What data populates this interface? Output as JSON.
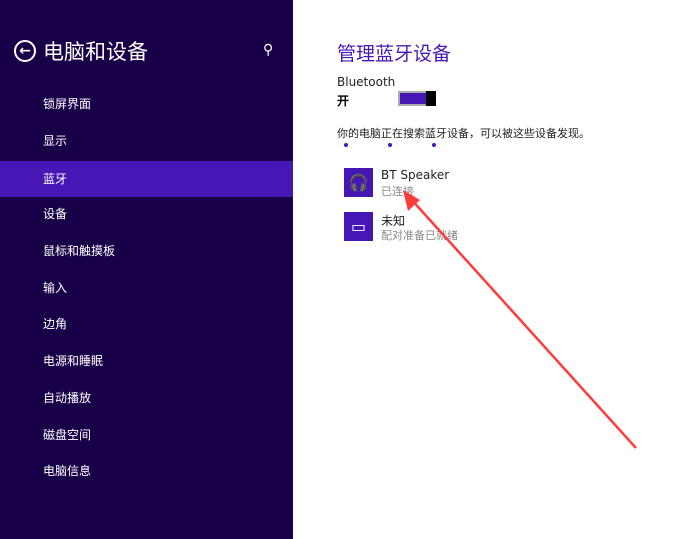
{
  "sidebar": {
    "title": "电脑和设备",
    "items": [
      {
        "label": "锁屏界面"
      },
      {
        "label": "显示"
      },
      {
        "label": "蓝牙",
        "selected": true
      },
      {
        "label": "设备"
      },
      {
        "label": "鼠标和触摸板"
      },
      {
        "label": "输入"
      },
      {
        "label": "边角"
      },
      {
        "label": "电源和睡眠"
      },
      {
        "label": "自动播放"
      },
      {
        "label": "磁盘空间"
      },
      {
        "label": "电脑信息"
      }
    ]
  },
  "main": {
    "title": "管理蓝牙设备",
    "bluetooth_label": "Bluetooth",
    "bluetooth_state": "开",
    "status": "你的电脑正在搜索蓝牙设备，可以被这些设备发现。",
    "devices": [
      {
        "name": "BT Speaker",
        "status": "已连接",
        "icon": "headset-icon"
      },
      {
        "name": "未知",
        "status": "配对准备已就绪",
        "icon": "devices-icon"
      }
    ]
  },
  "colors": {
    "sidebar": "#180048",
    "accent": "#4617b4",
    "annotation": "#ff3b3b"
  }
}
